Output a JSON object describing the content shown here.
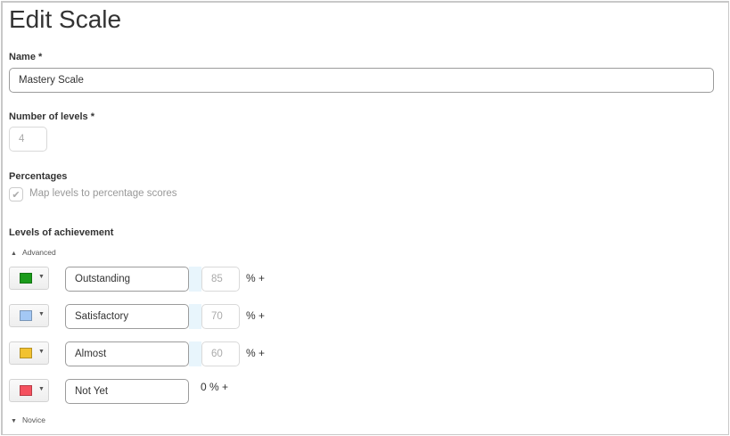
{
  "title": "Edit Scale",
  "name": {
    "label": "Name *",
    "value": "Mastery Scale"
  },
  "levels_count": {
    "label": "Number of levels *",
    "value": "4"
  },
  "percentages": {
    "label": "Percentages",
    "checkbox_label": "Map levels to percentage scores",
    "checked": true
  },
  "achievement": {
    "label": "Levels of achievement",
    "top_toggle": "Advanced",
    "bottom_toggle": "Novice",
    "levels": [
      {
        "name": "Outstanding",
        "color": "#1a9b1a",
        "percent": "85",
        "suffix": "% +"
      },
      {
        "name": "Satisfactory",
        "color": "#a3c8f5",
        "percent": "70",
        "suffix": "% +"
      },
      {
        "name": "Almost",
        "color": "#f2c230",
        "percent": "60",
        "suffix": "% +"
      },
      {
        "name": "Not Yet",
        "color": "#f5515f",
        "fixed": "0 % +"
      }
    ]
  }
}
